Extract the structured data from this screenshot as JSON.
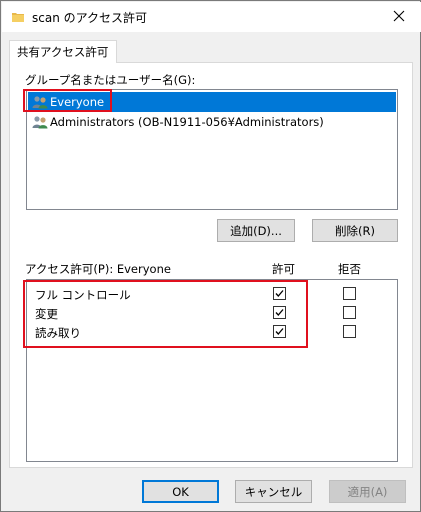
{
  "window": {
    "title": "scan のアクセス許可",
    "close_icon": "close-icon",
    "title_icon": "folder-icon"
  },
  "tab": {
    "label": "共有アクセス許可"
  },
  "groups": {
    "label": "グループ名またはユーザー名(G):",
    "items": [
      {
        "label": "Everyone",
        "icon": "users-group-icon",
        "selected": true
      },
      {
        "label": "Administrators (OB-N1911-056¥Administrators)",
        "icon": "users-group-icon",
        "selected": false
      }
    ],
    "add_button": "追加(D)...",
    "remove_button": "削除(R)"
  },
  "permissions": {
    "label": "アクセス許可(P): Everyone",
    "allow_header": "許可",
    "deny_header": "拒否",
    "rows": [
      {
        "name": "フル コントロール",
        "allow": true,
        "deny": false
      },
      {
        "name": "変更",
        "allow": true,
        "deny": false
      },
      {
        "name": "読み取り",
        "allow": true,
        "deny": false
      }
    ]
  },
  "footer": {
    "ok": "OK",
    "cancel": "キャンセル",
    "apply": "適用(A)"
  },
  "colors": {
    "selection": "#0078d7",
    "highlight_box": "#e0101e"
  }
}
